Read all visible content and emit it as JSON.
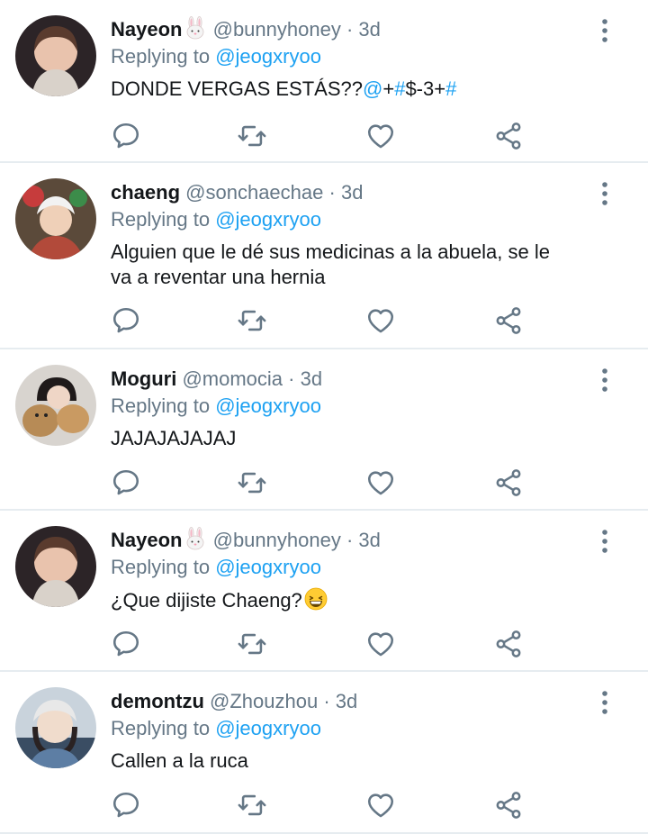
{
  "replying_label": "Replying to",
  "tweets": [
    {
      "name": "Nayeon",
      "emoji": "rabbit-emoji",
      "handle": "@bunnyhoney",
      "dot": "·",
      "time": "3d",
      "reply_to": "@jeogxryoo",
      "text_parts": [
        "DONDE VERGAS ESTÁS??",
        "@",
        "+",
        "#",
        "$-3+",
        "#"
      ]
    },
    {
      "name": "chaeng",
      "emoji": "",
      "handle": "@sonchaechae",
      "dot": "·",
      "time": "3d",
      "reply_to": "@jeogxryoo",
      "text_lines": [
        "Alguien que le dé sus medicinas a la abuela, se le",
        "va a reventar una hernia"
      ]
    },
    {
      "name": "Moguri",
      "emoji": "",
      "handle": "@momocia",
      "dot": "·",
      "time": "3d",
      "reply_to": "@jeogxryoo",
      "text": "JAJAJAJAJAJ"
    },
    {
      "name": "Nayeon",
      "emoji": "rabbit-emoji",
      "handle": "@bunnyhoney",
      "dot": "·",
      "time": "3d",
      "reply_to": "@jeogxryoo",
      "text": "¿Que dijiste Chaeng?",
      "text_emoji": "grinning-squinting-face"
    },
    {
      "name": "demontzu",
      "emoji": "",
      "handle": "@Zhouzhou",
      "dot": "·",
      "time": "3d",
      "reply_to": "@jeogxryoo",
      "text": "Callen a la ruca"
    }
  ],
  "icons": {
    "reply": "reply-icon",
    "retweet": "retweet-icon",
    "like": "heart-icon",
    "share": "share-icon",
    "more": "more-vertical-icon"
  },
  "colors": {
    "link": "#1da1f2",
    "secondary": "#657786",
    "divider": "#e6ecf0",
    "icon": "#657786"
  }
}
